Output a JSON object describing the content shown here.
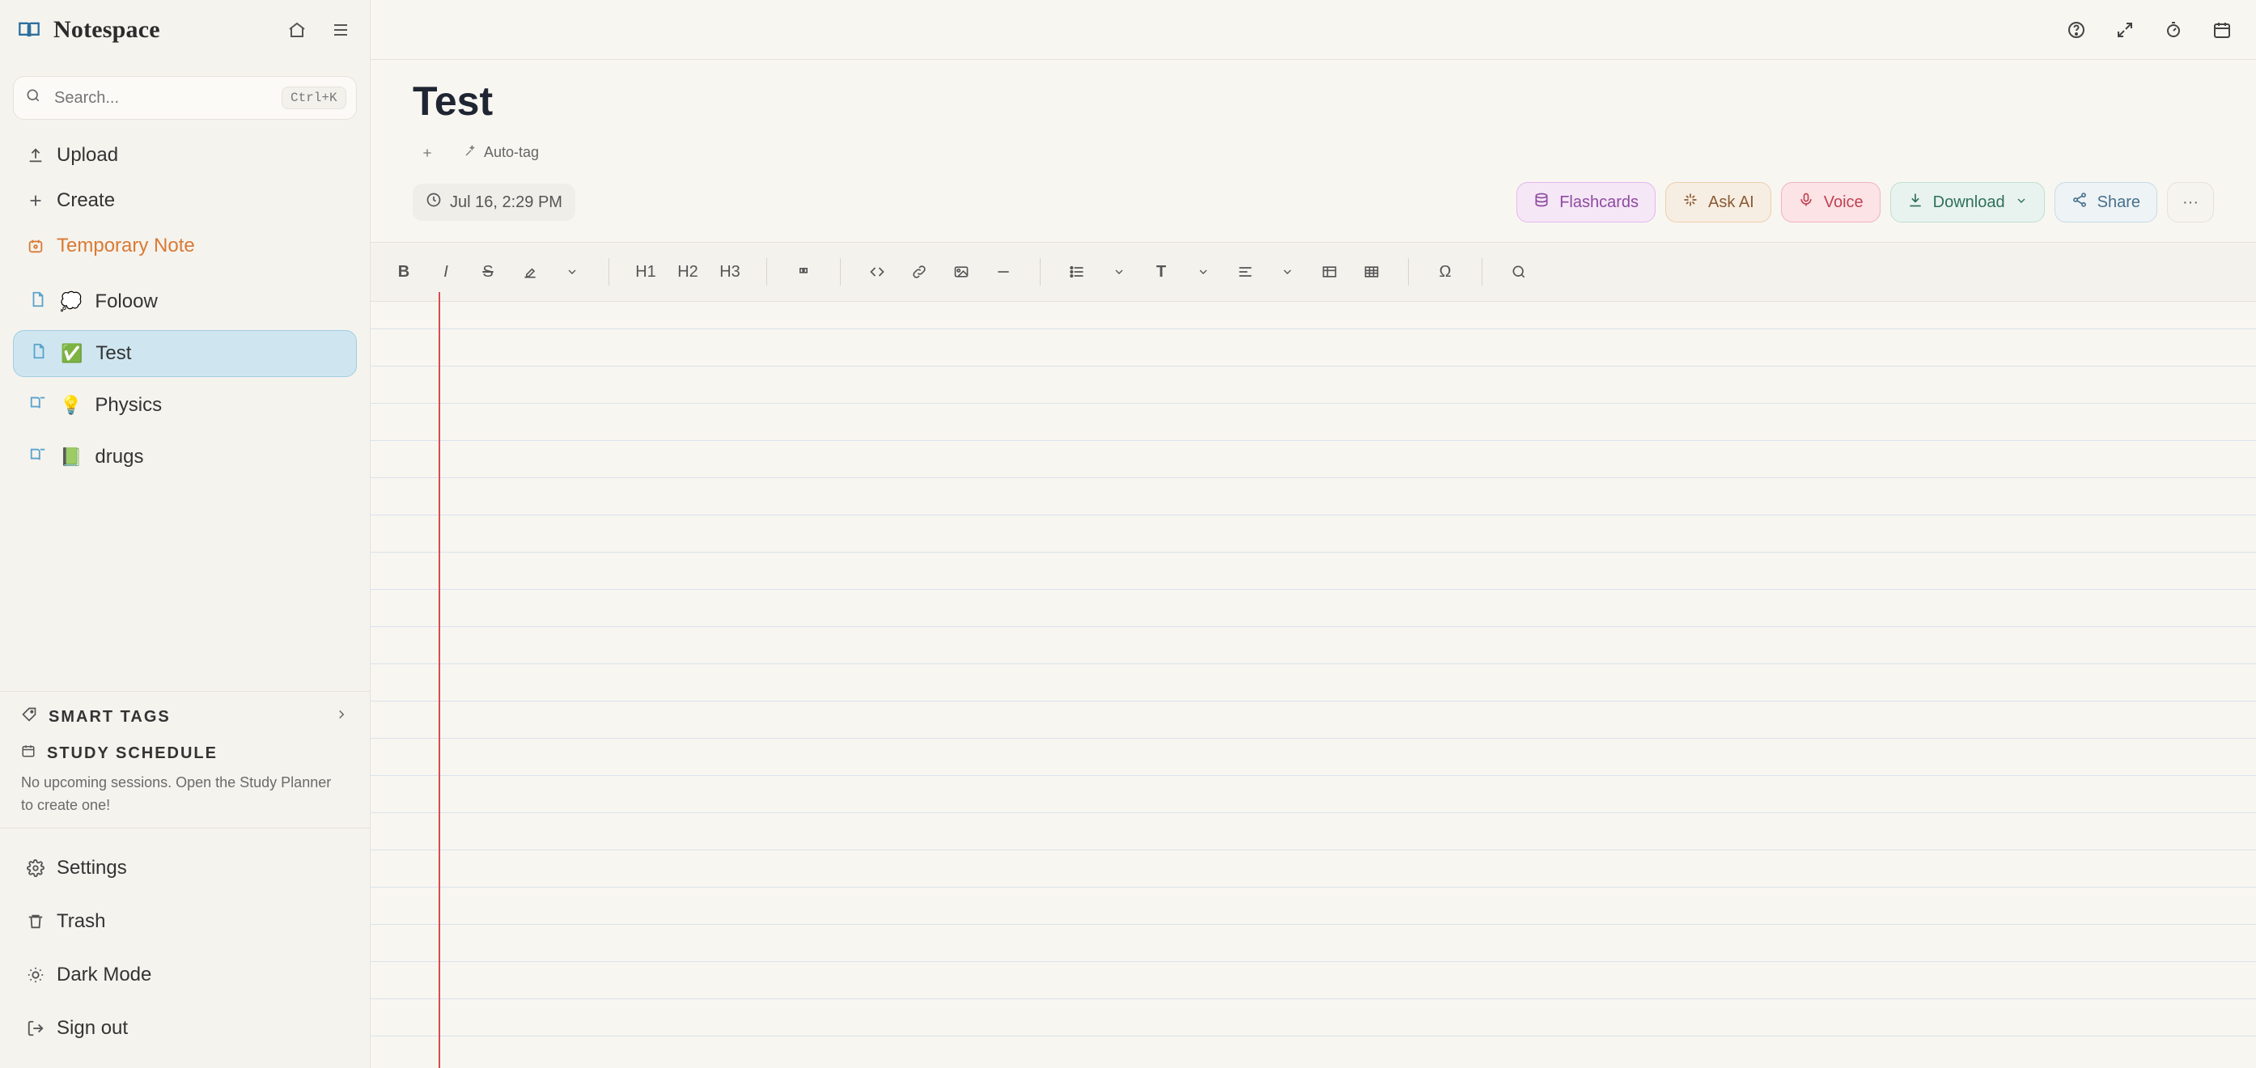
{
  "app": {
    "brand": "Notespace",
    "search": {
      "placeholder": "Search...",
      "shortcut": "Ctrl+K"
    },
    "nav": {
      "upload": "Upload",
      "create": "Create",
      "temporary": "Temporary Note"
    },
    "notes": [
      {
        "emoji": "💭",
        "label": "Foloow"
      },
      {
        "emoji": "✅",
        "label": "Test"
      },
      {
        "emoji": "💡",
        "label": "Physics"
      },
      {
        "emoji": "📗",
        "label": "drugs"
      }
    ],
    "smart_tags": {
      "title": "SMART TAGS"
    },
    "study": {
      "title": "STUDY SCHEDULE",
      "text": "No upcoming sessions. Open the Study Planner to create one!"
    },
    "footer": {
      "settings": "Settings",
      "trash": "Trash",
      "dark": "Dark Mode",
      "signout": "Sign out"
    }
  },
  "main": {
    "title": "Test",
    "auto_tag": "Auto-tag",
    "date": "Jul 16, 2:29 PM",
    "actions": {
      "flashcards": "Flashcards",
      "ask_ai": "Ask AI",
      "voice": "Voice",
      "download": "Download",
      "share": "Share",
      "more": "···"
    },
    "toolbar": {
      "h1": "H1",
      "h2": "H2",
      "h3": "H3",
      "omega": "Ω"
    }
  },
  "colors": {
    "accent": "#d97a34",
    "active": "#cfe6f1",
    "margin_line": "#d54d4d"
  }
}
